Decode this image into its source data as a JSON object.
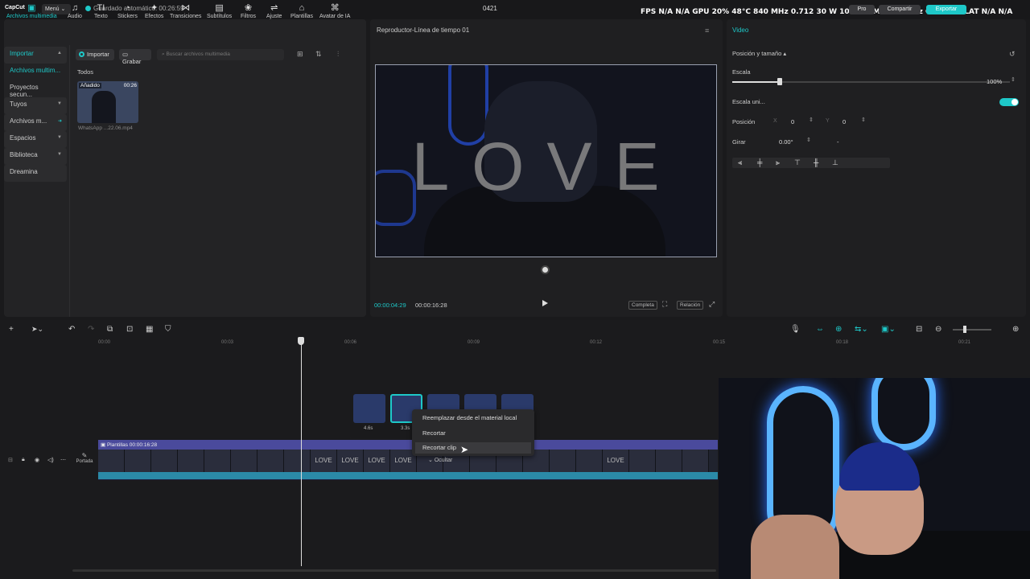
{
  "app": {
    "logo": "CapCut",
    "menu": "Menú",
    "autosave": "Guardado automático: 00:26:59",
    "project": "0421"
  },
  "perf": "FPS N/A N/A   GPU 20% 48°C 840 MHz 0.712 30 W 1041 RPM 5000 MHz   CPU 17%   LAT N/A N/A",
  "header_buttons": {
    "pro": "Pro",
    "share": "Compartir",
    "export": "Exportar"
  },
  "tools": [
    "Archivos multimedia",
    "Audio",
    "Texto",
    "Stickers",
    "Efectos",
    "Transiciones",
    "Subtítulos",
    "Filtros",
    "Ajuste",
    "Plantillas",
    "Avatar de IA"
  ],
  "tool_icons": [
    "▣",
    "♫",
    "TI",
    "◔",
    "✦",
    "⋈",
    "▤",
    "❀",
    "⇌",
    "⌂",
    "⌘"
  ],
  "sidebar": [
    "Importar",
    "Archivos multim...",
    "Proyectos secun...",
    "Tuyos",
    "Archivos m...",
    "Espacios",
    "Biblioteca",
    "Dreamina"
  ],
  "media": {
    "import": "Importar",
    "record": "Grabar",
    "search_placeholder": "Buscar archivos multimedia",
    "section": "Todos",
    "thumb_tag": "Añadido",
    "thumb_dur": "00:26",
    "thumb_name": "WhatsApp ...22.06.mp4"
  },
  "player": {
    "title": "Reproductor-Línea de tiempo 01",
    "overlay_text": "LOVE",
    "time_current": "00:00:04:29",
    "time_total": "00:00:16:28",
    "btn_full": "Completa",
    "btn_ratio": "Relación"
  },
  "props": {
    "tab": "Video",
    "section": "Posición y tamaño",
    "scale_label": "Escala",
    "scale_value": "100%",
    "scale_fraction": 0.17,
    "uniform_label": "Escala uni...",
    "position_label": "Posición",
    "x_label": "X",
    "x_value": "0",
    "y_label": "Y",
    "y_value": "0",
    "rotate_label": "Girar",
    "rotate_value": "0.00°",
    "rotate_reset": "-"
  },
  "ruler": [
    "00:00",
    "00:03",
    "00:06",
    "00:09",
    "00:12",
    "00:15",
    "00:18",
    "00:21"
  ],
  "track": {
    "label": "Plantillas  00:00:16:28",
    "cover": "Portada",
    "hide": "Ocultar",
    "frame_text": [
      "LOVE",
      "LOVE",
      "LOVE",
      "LOVE",
      "LOVE"
    ]
  },
  "popup": {
    "clip1_dur": "4.6s",
    "clip2_dur": "3.3s"
  },
  "context_menu": [
    "Reemplazar desde el material local",
    "Recortar",
    "Recortar clip"
  ]
}
